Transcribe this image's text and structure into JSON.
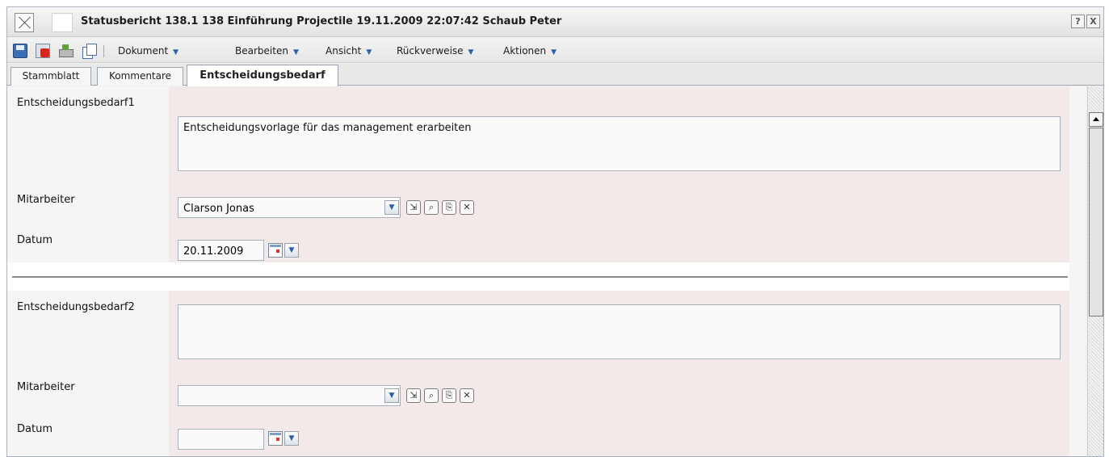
{
  "window": {
    "title": "Statusbericht 138.1 138 Einführung Projectile 19.11.2009 22:07:42 Schaub Peter",
    "help_label": "?",
    "close_label": "X"
  },
  "toolbar": {
    "menus": [
      {
        "label": "Dokument"
      },
      {
        "label": "Bearbeiten"
      },
      {
        "label": "Ansicht"
      },
      {
        "label": "Rückverweise"
      },
      {
        "label": "Aktionen"
      }
    ]
  },
  "tabs": [
    {
      "label": "Stammblatt",
      "active": false
    },
    {
      "label": "Kommentare",
      "active": false
    },
    {
      "label": "Entscheidungsbedarf",
      "active": true
    }
  ],
  "entries": [
    {
      "label": "Entscheidungsbedarf1",
      "text": "Entscheidungsvorlage für das management erarbeiten",
      "mitarbeiter_label": "Mitarbeiter",
      "mitarbeiter_value": "Clarson Jonas",
      "datum_label": "Datum",
      "datum_value": "20.11.2009"
    },
    {
      "label": "Entscheidungsbedarf2",
      "text": "",
      "mitarbeiter_label": "Mitarbeiter",
      "mitarbeiter_value": "",
      "datum_label": "Datum",
      "datum_value": ""
    }
  ],
  "icons": {
    "field_buttons": [
      "goto-icon",
      "search-icon",
      "copy-icon",
      "clear-icon"
    ]
  },
  "colors": {
    "accent": "#2d5fa8",
    "row_background": "#f3e9e9",
    "delete_red": "#d4261e"
  }
}
